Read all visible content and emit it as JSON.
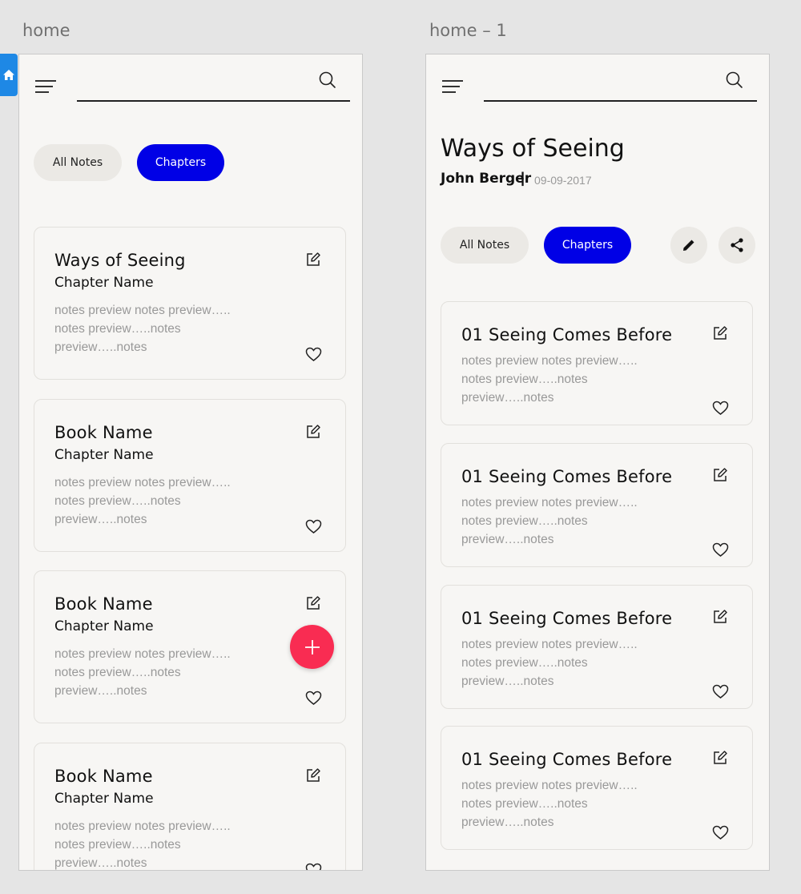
{
  "colors": {
    "accent_blue": "#0000e6",
    "fab_red": "#f92c52",
    "home_tab_blue": "#1e88e5",
    "background": "#f7f6f4",
    "canvas": "#e5e5e5"
  },
  "artboards": [
    {
      "label": "home",
      "tabs": {
        "all_notes": "All Notes",
        "chapters": "Chapters"
      },
      "cards": [
        {
          "title": "Ways of Seeing",
          "chapter": "Chapter Name",
          "preview": "notes preview notes preview….. notes preview…..notes preview…..notes"
        },
        {
          "title": "Book Name",
          "chapter": "Chapter Name",
          "preview": "notes preview notes preview….. notes preview…..notes preview…..notes"
        },
        {
          "title": "Book Name",
          "chapter": "Chapter Name",
          "preview": "notes preview notes preview….. notes preview…..notes preview…..notes"
        },
        {
          "title": "Book Name",
          "chapter": "Chapter Name",
          "preview": "notes preview notes preview….. notes preview…..notes preview…..notes"
        }
      ],
      "fab_icon": "plus-icon"
    },
    {
      "label": "home – 1",
      "book": {
        "title": "Ways of Seeing",
        "author": "John Berger",
        "separator": "|",
        "date": "09-09-2017"
      },
      "tabs": {
        "all_notes": "All Notes",
        "chapters": "Chapters"
      },
      "actions": [
        "pencil-icon",
        "share-icon"
      ],
      "cards": [
        {
          "title": "01 Seeing Comes Before",
          "preview": "notes preview notes preview….. notes preview…..notes preview…..notes"
        },
        {
          "title": "01 Seeing Comes Before",
          "preview": "notes preview notes preview….. notes preview…..notes preview…..notes"
        },
        {
          "title": "01 Seeing Comes Before",
          "preview": "notes preview notes preview….. notes preview…..notes preview…..notes"
        },
        {
          "title": "01 Seeing Comes Before",
          "preview": "notes preview notes preview….. notes preview…..notes preview…..notes"
        }
      ]
    }
  ]
}
